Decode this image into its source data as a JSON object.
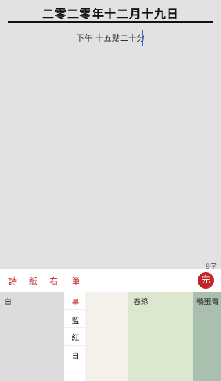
{
  "document": {
    "title": "二零二零年十二月十九日",
    "body_text": "下午 十五點二十分",
    "char_count": "9字"
  },
  "toolbar": {
    "tabs": [
      "詩",
      "紙",
      "右",
      "筆"
    ],
    "done_label": "完",
    "accent_color": "#c0262a"
  },
  "palette": {
    "selected_paper": "白",
    "ink_colors": [
      "墨",
      "藍",
      "紅",
      "白"
    ],
    "active_ink": "墨",
    "paper_swatches": [
      {
        "label": "白",
        "color": "#dcdcdc"
      },
      {
        "label": "",
        "color": "#f3f1ea"
      },
      {
        "label": "春綠",
        "color": "#dbe8cf"
      },
      {
        "label": "鴨蛋青",
        "color": "#a9c0ae"
      }
    ]
  }
}
